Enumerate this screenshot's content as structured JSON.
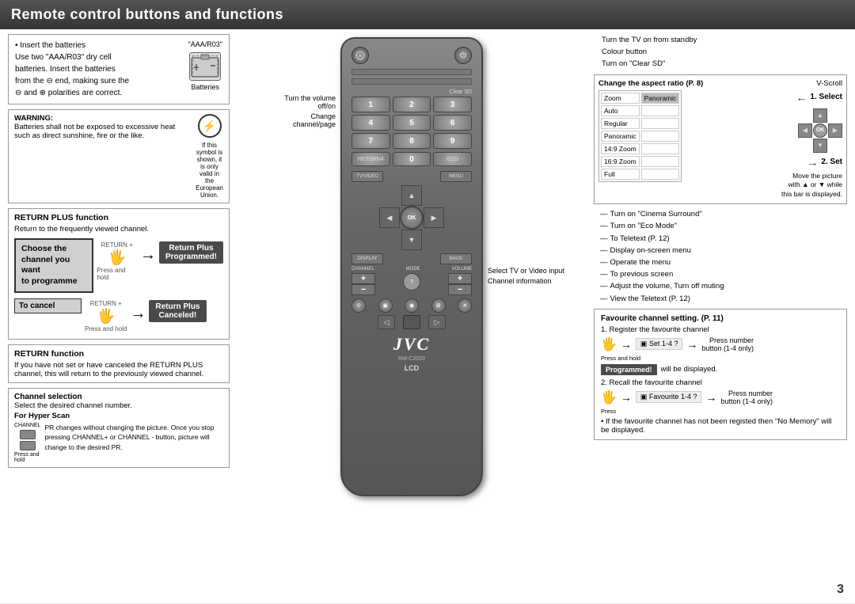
{
  "header": {
    "title": "Remote control buttons and functions"
  },
  "battery_section": {
    "instruction1": "• Insert the batteries",
    "instruction2": "Use two \"AAA/R03\" dry cell",
    "instruction3": "batteries. Insert the batteries",
    "instruction4": "from the ⊖ end, making sure the",
    "instruction5": "⊖ and ⊕ polarities are correct.",
    "label": "\"AAA/R03\"",
    "label2": "Batteries"
  },
  "warning_section": {
    "title": "WARNING:",
    "text": "Batteries shall not be exposed to excessive heat such as direct sunshine, fire or the like.",
    "symbol_text": "If this symbol is shown, it is only valid in the European Union."
  },
  "return_plus": {
    "title": "RETURN PLUS function",
    "desc": "Return to the frequently viewed channel.",
    "choose_channel": "Choose the\nchannel you want\nto programme",
    "press_hold": "Press and hold",
    "return_plus_label": "RETURN +",
    "to_cancel": "To cancel",
    "programmed": "Return Plus\nProgrammed!",
    "canceled": "Return Plus\nCanceled!"
  },
  "return_function": {
    "title": "RETURN function",
    "text": "If you have not set or have canceled the RETURN PLUS channel, this will return to the previously viewed channel."
  },
  "channel_selection": {
    "title": "Channel selection",
    "text": "Select the desired channel number.",
    "hyper_scan": "For Hyper Scan",
    "channel_label": "CHANNEL",
    "press_hold": "Press and hold",
    "desc": "PR changes without changing the picture. Once you stop pressing CHANNEL+ or CHANNEL - button, picture will change to the desired PR."
  },
  "right_annotations": {
    "turn_on_standby": "Turn the TV on from standby",
    "colour_button": "Colour button",
    "turn_clear_sd": "Turn on \"Clear SD\"",
    "change_aspect": "Change the aspect ratio (P. 8)",
    "vscroll": "V-Scroll",
    "select_1": "1. Select",
    "set_2": "2. Set",
    "move_picture": "Move the picture with ▲ or ▼ while this bar is displayed.",
    "cinema_surround": "Turn on \"Cinema Surround\"",
    "eco_mode": "Turn on \"Eco Mode\"",
    "teletext": "To Teletext (P. 12)",
    "display_onscreen": "Display on-screen menu",
    "operate_menu": "Operate the menu",
    "previous_screen": "To previous screen",
    "adjust_volume": "Adjust the volume, Turn off muting",
    "view_teletext": "View the Teletext (P. 12)"
  },
  "favourite_section": {
    "title": "Favourite channel setting. (P. 11)",
    "register_title": "1. Register the favourite channel",
    "press_hold": "Press and hold",
    "set_badge": "▣ Set 1-4 ?",
    "press_number": "Press number",
    "button_1_4": "button (1-4 only)",
    "programmed_badge": "Programmed!",
    "will_displayed": "will be displayed.",
    "recall_title": "2. Recall the favourite channel",
    "press": "Press",
    "favourite_badge": "▣ Favourite 1-4 ?",
    "press_number2": "Press number",
    "button_1_4_2": "button (1-4 only)",
    "if_note": "• If the favourite channel has not been registed then \"No Memory\" will be displayed."
  },
  "remote": {
    "model": "RM-C2020",
    "lcd": "LCD"
  },
  "zoom_options": {
    "options": [
      "Zoom",
      "Auto",
      "Regular",
      "Panoramic",
      "14:9 Zoom",
      "16:9 Zoom",
      "Full"
    ]
  },
  "page_number": "3",
  "volume_label": "Turn the volume off/on",
  "channel_page_label": "Change channel/page",
  "select_tv_label": "Select TV or Video input",
  "channel_info_label": "Channel information"
}
